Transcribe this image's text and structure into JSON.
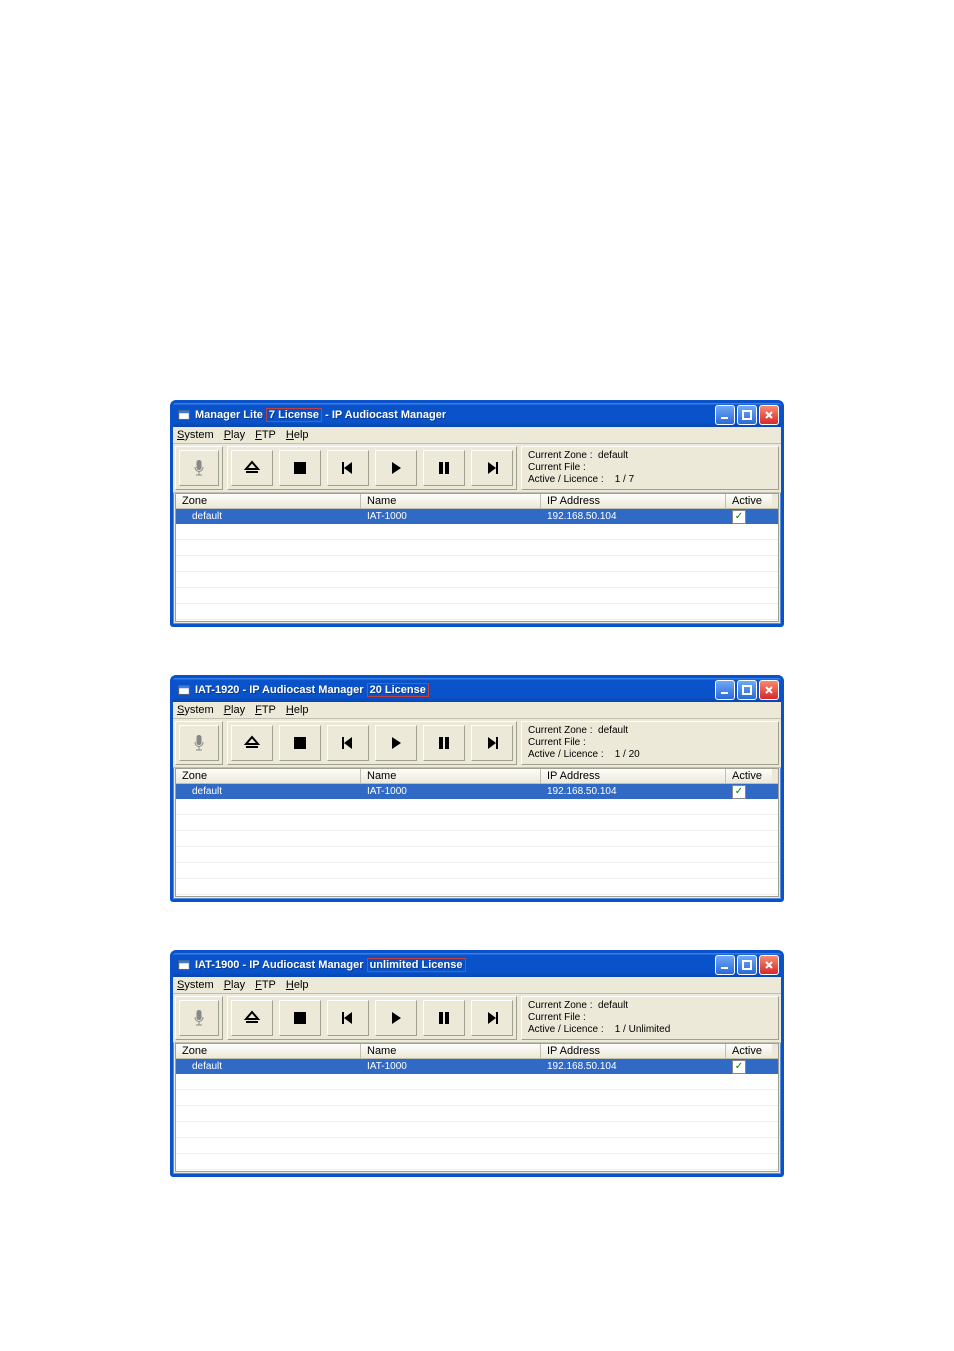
{
  "windows": [
    {
      "title_pre": "Manager Lite ",
      "title_boxed": "7 License",
      "title_post": " - IP Audiocast Manager",
      "menus": {
        "system": "System",
        "play": "Play",
        "ftp": "FTP",
        "help": "Help"
      },
      "status": {
        "current_zone_label": "Current Zone :",
        "current_zone_value": "default",
        "current_file_label": "Current File :",
        "current_file_value": "",
        "active_licence_label": "Active / Licence :",
        "active_licence_value": "1 /    7"
      },
      "columns": {
        "zone": "Zone",
        "name": "Name",
        "ip": "IP Address",
        "active": "Active"
      },
      "row": {
        "zone": "default",
        "name": "IAT-1000",
        "ip": "192.168.50.104",
        "active_checked": "✓"
      }
    },
    {
      "title_pre": "IAT-1920 - IP Audiocast Manager ",
      "title_boxed": "20 License",
      "title_post": "",
      "menus": {
        "system": "System",
        "play": "Play",
        "ftp": "FTP",
        "help": "Help"
      },
      "status": {
        "current_zone_label": "Current Zone :",
        "current_zone_value": "default",
        "current_file_label": "Current File :",
        "current_file_value": "",
        "active_licence_label": "Active / Licence :",
        "active_licence_value": "1 /    20"
      },
      "columns": {
        "zone": "Zone",
        "name": "Name",
        "ip": "IP Address",
        "active": "Active"
      },
      "row": {
        "zone": "default",
        "name": "IAT-1000",
        "ip": "192.168.50.104",
        "active_checked": "✓"
      }
    },
    {
      "title_pre": "IAT-1900 - IP Audiocast Manager ",
      "title_boxed": "unlimited License",
      "title_post": "",
      "menus": {
        "system": "System",
        "play": "Play",
        "ftp": "FTP",
        "help": "Help"
      },
      "status": {
        "current_zone_label": "Current Zone :",
        "current_zone_value": "default",
        "current_file_label": "Current File :",
        "current_file_value": "",
        "active_licence_label": "Active / Licence :",
        "active_licence_value": "1 / Unlimited"
      },
      "columns": {
        "zone": "Zone",
        "name": "Name",
        "ip": "IP Address",
        "active": "Active"
      },
      "row": {
        "zone": "default",
        "name": "IAT-1000",
        "ip": "192.168.50.104",
        "active_checked": "✓"
      }
    }
  ]
}
